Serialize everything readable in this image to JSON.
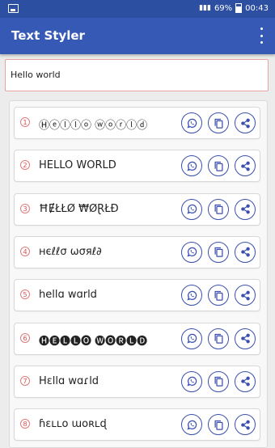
{
  "status_bar": {
    "battery": "69%",
    "time": "00:43"
  },
  "app": {
    "title": "Text Styler"
  },
  "input": {
    "value": "Hello world"
  },
  "styles": [
    {
      "num": "1",
      "text": "Ⓗⓔⓛⓛⓞ ⓦⓞⓡⓛⓓ"
    },
    {
      "num": "2",
      "text": "HELLO WORLD"
    },
    {
      "num": "3",
      "text": "ĦɆŁŁØ ₩ØⱤŁĐ"
    },
    {
      "num": "4",
      "text": "нєℓℓσ ωσяℓ∂"
    },
    {
      "num": "5",
      "text": "hellɑ wɑrld"
    },
    {
      "num": "6",
      "text": "🅗🅔🅛🅛🅞 🅦🅞🅡🅛🅓"
    },
    {
      "num": "7",
      "text": "Hɛllɑ wɑɾld"
    },
    {
      "num": "8",
      "text": "ɦɛʟʟօ աօʀʟɖ"
    }
  ]
}
